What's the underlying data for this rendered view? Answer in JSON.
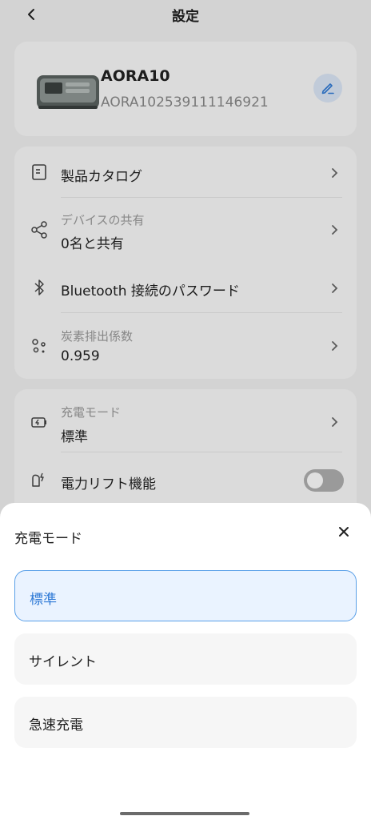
{
  "header": {
    "title": "設定"
  },
  "device": {
    "name": "AORA10",
    "serial": "AORA102539111146921"
  },
  "menu": {
    "catalog_label": "製品カタログ",
    "share_label": "デバイスの共有",
    "share_value": "0名と共有",
    "bluetooth_label": "Bluetooth 接続のパスワード",
    "carbon_label": "炭素排出係数",
    "carbon_value": "0.959"
  },
  "charge": {
    "label": "充電モード",
    "value": "標準",
    "lift_label": "電力リフト機能",
    "lift_enabled": false
  },
  "sheet": {
    "title": "充電モード",
    "options": [
      {
        "label": "標準",
        "selected": true
      },
      {
        "label": "サイレント",
        "selected": false
      },
      {
        "label": "急速充電",
        "selected": false
      }
    ]
  },
  "colors": {
    "accent": "#2f7ad6",
    "selected_bg": "#eaf3ff"
  }
}
